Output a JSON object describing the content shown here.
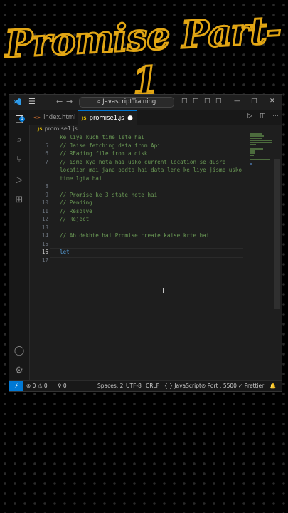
{
  "headline": "Promise Part-1",
  "titlebar": {
    "search_text": "JavascriptTraining",
    "menu_icon": "hamburger-icon",
    "controls": [
      "□",
      "□",
      "□",
      "□",
      "—",
      "□",
      "✕"
    ]
  },
  "activity_bar": {
    "badge": "1",
    "items": [
      "explorer-icon",
      "search-icon",
      "source-control-icon",
      "run-debug-icon",
      "extensions-icon"
    ],
    "bottom": [
      "account-icon",
      "settings-icon"
    ]
  },
  "tabs": [
    {
      "label": "index.html",
      "icon": "<>",
      "active": false
    },
    {
      "label": "promise1.js",
      "icon": "JS",
      "active": true,
      "modified": true
    }
  ],
  "breadcrumb": {
    "icon": "JS",
    "file": "promise1.js"
  },
  "code_lines": [
    {
      "num": "",
      "text": "ke liye kuch time lete hai",
      "type": "comment"
    },
    {
      "num": "5",
      "text": "// Jaise fetching data from Api",
      "type": "comment"
    },
    {
      "num": "6",
      "text": "// REading file from a disk",
      "type": "comment"
    },
    {
      "num": "7",
      "text": "// isme kya hota hai usko current location se dusre",
      "type": "comment"
    },
    {
      "num": "",
      "text": "location mai jana padta hai data lene ke liye jisme usko",
      "type": "comment"
    },
    {
      "num": "",
      "text": "time lgta hai",
      "type": "comment"
    },
    {
      "num": "8",
      "text": "",
      "type": "blank"
    },
    {
      "num": "9",
      "text": "// Promise ke 3 state hote hai",
      "type": "comment"
    },
    {
      "num": "10",
      "text": "// Pending",
      "type": "comment"
    },
    {
      "num": "11",
      "text": "// Resolve",
      "type": "comment"
    },
    {
      "num": "12",
      "text": "// Reject",
      "type": "comment"
    },
    {
      "num": "13",
      "text": "",
      "type": "blank"
    },
    {
      "num": "14",
      "text": "// Ab dekhte hai Promise create kaise krte hai",
      "type": "comment"
    },
    {
      "num": "15",
      "text": "",
      "type": "blank"
    },
    {
      "num": "16",
      "text": "let",
      "type": "keyword",
      "current": true
    },
    {
      "num": "17",
      "text": "",
      "type": "blank"
    }
  ],
  "statusbar": {
    "remote": "⚡",
    "errors": "⊗ 0 ⚠ 0",
    "ports": "⚲ 0",
    "spaces": "Spaces: 2",
    "encoding": "UTF-8",
    "eol": "CRLF",
    "language": "{ } JavaScript",
    "port": "⊘ Port : 5500",
    "prettier": "✓ Prettier",
    "bell": "🔔"
  },
  "colors": {
    "accent": "#0078d4",
    "headline": "#e2a614",
    "comment": "#6a9955",
    "keyword": "#569cd6"
  }
}
